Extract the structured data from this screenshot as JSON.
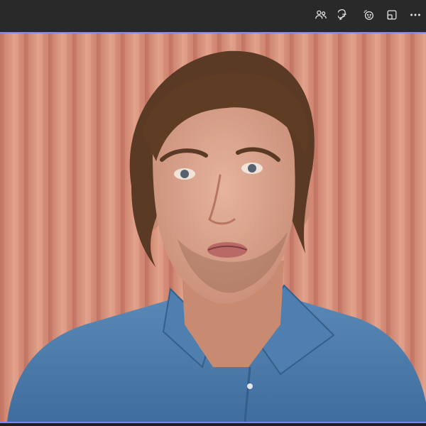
{
  "toolbar": {
    "icons": [
      "people-icon",
      "chat-icon",
      "reactions-icon",
      "view-layout-icon",
      "more-options-icon"
    ]
  },
  "colors": {
    "toolbar_bg": "#292929",
    "accent_border": "#7f85f5",
    "curtain": "#d38a72",
    "shirt": "#4a78a8",
    "skin": "#d9a48e",
    "hair": "#5a3a24"
  }
}
